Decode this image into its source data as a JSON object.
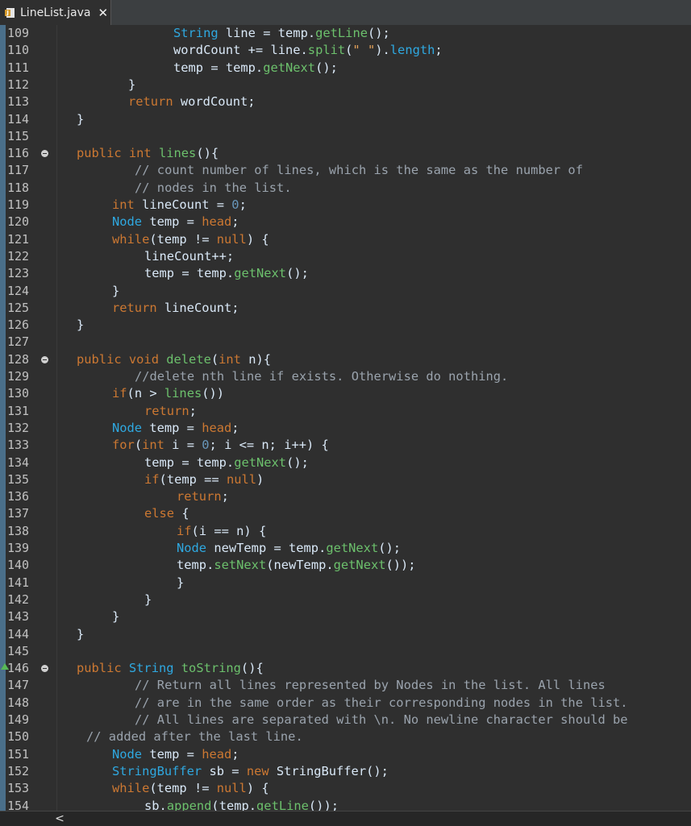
{
  "tab": {
    "label": "LineList.java",
    "close": "✕"
  },
  "scroll": {
    "left": "<"
  },
  "lines": [
    {
      "n": "109",
      "indent": 4,
      "fold": false,
      "marker": false,
      "tokens": [
        [
          "ty",
          "String"
        ],
        [
          "id",
          " line "
        ],
        [
          "id",
          "= "
        ],
        [
          "id",
          "temp."
        ],
        [
          "fn",
          "getLine"
        ],
        [
          "id",
          "();"
        ]
      ]
    },
    {
      "n": "110",
      "indent": 4,
      "fold": false,
      "marker": false,
      "tokens": [
        [
          "id",
          "wordCount += line."
        ],
        [
          "fn",
          "split"
        ],
        [
          "id",
          "("
        ],
        [
          "str",
          "\" \""
        ],
        [
          "id",
          ")."
        ],
        [
          "ty",
          "length"
        ],
        [
          "id",
          ";"
        ]
      ]
    },
    {
      "n": "111",
      "indent": 4,
      "fold": false,
      "marker": false,
      "tokens": [
        [
          "id",
          "temp = temp."
        ],
        [
          "fn",
          "getNext"
        ],
        [
          "id",
          "();"
        ]
      ]
    },
    {
      "n": "112",
      "indent": 2.6,
      "fold": false,
      "marker": false,
      "tokens": [
        [
          "id",
          "}"
        ]
      ]
    },
    {
      "n": "113",
      "indent": 2.6,
      "fold": false,
      "marker": false,
      "tokens": [
        [
          "kw",
          "return"
        ],
        [
          "id",
          " wordCount;"
        ]
      ]
    },
    {
      "n": "114",
      "indent": 1,
      "fold": false,
      "marker": false,
      "tokens": [
        [
          "id",
          "}"
        ]
      ]
    },
    {
      "n": "115",
      "indent": 0,
      "fold": false,
      "marker": false,
      "tokens": []
    },
    {
      "n": "116",
      "indent": 1,
      "fold": true,
      "marker": false,
      "tokens": [
        [
          "kw",
          "public"
        ],
        [
          "id",
          " "
        ],
        [
          "kw",
          "int"
        ],
        [
          "id",
          " "
        ],
        [
          "fn",
          "lines"
        ],
        [
          "id",
          "(){"
        ]
      ]
    },
    {
      "n": "117",
      "indent": 2.8,
      "fold": false,
      "marker": false,
      "tokens": [
        [
          "cm",
          "// count number of lines, which is the same as the number of"
        ]
      ]
    },
    {
      "n": "118",
      "indent": 2.8,
      "fold": false,
      "marker": false,
      "tokens": [
        [
          "cm",
          "// nodes in the list."
        ]
      ]
    },
    {
      "n": "119",
      "indent": 2.1,
      "fold": false,
      "marker": false,
      "tokens": [
        [
          "kw",
          "int"
        ],
        [
          "id",
          " lineCount = "
        ],
        [
          "num",
          "0"
        ],
        [
          "id",
          ";"
        ]
      ]
    },
    {
      "n": "120",
      "indent": 2.1,
      "fold": false,
      "marker": false,
      "tokens": [
        [
          "ty",
          "Node"
        ],
        [
          "id",
          " temp = "
        ],
        [
          "kw",
          "head"
        ],
        [
          "id",
          ";"
        ]
      ]
    },
    {
      "n": "121",
      "indent": 2.1,
      "fold": false,
      "marker": false,
      "tokens": [
        [
          "kw",
          "while"
        ],
        [
          "id",
          "(temp != "
        ],
        [
          "kw",
          "null"
        ],
        [
          "id",
          ") {"
        ]
      ]
    },
    {
      "n": "122",
      "indent": 3.1,
      "fold": false,
      "marker": false,
      "tokens": [
        [
          "id",
          "lineCount++;"
        ]
      ]
    },
    {
      "n": "123",
      "indent": 3.1,
      "fold": false,
      "marker": false,
      "tokens": [
        [
          "id",
          "temp = temp."
        ],
        [
          "fn",
          "getNext"
        ],
        [
          "id",
          "();"
        ]
      ]
    },
    {
      "n": "124",
      "indent": 2.1,
      "fold": false,
      "marker": false,
      "tokens": [
        [
          "id",
          "}"
        ]
      ]
    },
    {
      "n": "125",
      "indent": 2.1,
      "fold": false,
      "marker": false,
      "tokens": [
        [
          "kw",
          "return"
        ],
        [
          "id",
          " lineCount;"
        ]
      ]
    },
    {
      "n": "126",
      "indent": 1,
      "fold": false,
      "marker": false,
      "tokens": [
        [
          "id",
          "}"
        ]
      ]
    },
    {
      "n": "127",
      "indent": 0,
      "fold": false,
      "marker": false,
      "tokens": []
    },
    {
      "n": "128",
      "indent": 1,
      "fold": true,
      "marker": false,
      "tokens": [
        [
          "kw",
          "public"
        ],
        [
          "id",
          " "
        ],
        [
          "kw",
          "void"
        ],
        [
          "id",
          " "
        ],
        [
          "fn",
          "delete"
        ],
        [
          "id",
          "("
        ],
        [
          "kw",
          "int"
        ],
        [
          "id",
          " n){"
        ]
      ]
    },
    {
      "n": "129",
      "indent": 2.8,
      "fold": false,
      "marker": false,
      "tokens": [
        [
          "cm",
          "//delete nth line if exists. Otherwise do nothing."
        ]
      ]
    },
    {
      "n": "130",
      "indent": 2.1,
      "fold": false,
      "marker": false,
      "tokens": [
        [
          "kw",
          "if"
        ],
        [
          "id",
          "(n > "
        ],
        [
          "fn",
          "lines"
        ],
        [
          "id",
          "())"
        ]
      ]
    },
    {
      "n": "131",
      "indent": 3.1,
      "fold": false,
      "marker": false,
      "tokens": [
        [
          "kw",
          "return"
        ],
        [
          "id",
          ";"
        ]
      ]
    },
    {
      "n": "132",
      "indent": 2.1,
      "fold": false,
      "marker": false,
      "tokens": [
        [
          "ty",
          "Node"
        ],
        [
          "id",
          " temp = "
        ],
        [
          "kw",
          "head"
        ],
        [
          "id",
          ";"
        ]
      ]
    },
    {
      "n": "133",
      "indent": 2.1,
      "fold": false,
      "marker": false,
      "tokens": [
        [
          "kw",
          "for"
        ],
        [
          "id",
          "("
        ],
        [
          "kw",
          "int"
        ],
        [
          "id",
          " i = "
        ],
        [
          "num",
          "0"
        ],
        [
          "id",
          "; i <= n; i++) {"
        ]
      ]
    },
    {
      "n": "134",
      "indent": 3.1,
      "fold": false,
      "marker": false,
      "tokens": [
        [
          "id",
          "temp = temp."
        ],
        [
          "fn",
          "getNext"
        ],
        [
          "id",
          "();"
        ]
      ]
    },
    {
      "n": "135",
      "indent": 3.1,
      "fold": false,
      "marker": false,
      "tokens": [
        [
          "kw",
          "if"
        ],
        [
          "id",
          "(temp == "
        ],
        [
          "kw",
          "null"
        ],
        [
          "id",
          ")"
        ]
      ]
    },
    {
      "n": "136",
      "indent": 4.1,
      "fold": false,
      "marker": false,
      "tokens": [
        [
          "kw",
          "return"
        ],
        [
          "id",
          ";"
        ]
      ]
    },
    {
      "n": "137",
      "indent": 3.1,
      "fold": false,
      "marker": false,
      "tokens": [
        [
          "kw",
          "else"
        ],
        [
          "id",
          " {"
        ]
      ]
    },
    {
      "n": "138",
      "indent": 4.1,
      "fold": false,
      "marker": false,
      "tokens": [
        [
          "kw",
          "if"
        ],
        [
          "id",
          "(i == n) {"
        ]
      ]
    },
    {
      "n": "139",
      "indent": 4.1,
      "fold": false,
      "marker": false,
      "tokens": [
        [
          "ty",
          "Node"
        ],
        [
          "id",
          " newTemp = temp."
        ],
        [
          "fn",
          "getNext"
        ],
        [
          "id",
          "();"
        ]
      ]
    },
    {
      "n": "140",
      "indent": 4.1,
      "fold": false,
      "marker": false,
      "tokens": [
        [
          "id",
          "temp."
        ],
        [
          "fn",
          "setNext"
        ],
        [
          "id",
          "(newTemp."
        ],
        [
          "fn",
          "getNext"
        ],
        [
          "id",
          "());"
        ]
      ]
    },
    {
      "n": "141",
      "indent": 4.1,
      "fold": false,
      "marker": false,
      "tokens": [
        [
          "id",
          "}"
        ]
      ]
    },
    {
      "n": "142",
      "indent": 3.1,
      "fold": false,
      "marker": false,
      "tokens": [
        [
          "id",
          "}"
        ]
      ]
    },
    {
      "n": "143",
      "indent": 2.1,
      "fold": false,
      "marker": false,
      "tokens": [
        [
          "id",
          "}"
        ]
      ]
    },
    {
      "n": "144",
      "indent": 1,
      "fold": false,
      "marker": false,
      "tokens": [
        [
          "id",
          "}"
        ]
      ]
    },
    {
      "n": "145",
      "indent": 0,
      "fold": false,
      "marker": false,
      "tokens": []
    },
    {
      "n": "146",
      "indent": 1,
      "fold": true,
      "marker": true,
      "tokens": [
        [
          "kw",
          "public"
        ],
        [
          "id",
          " "
        ],
        [
          "ty",
          "String"
        ],
        [
          "id",
          " "
        ],
        [
          "fn",
          "toString"
        ],
        [
          "id",
          "(){"
        ]
      ]
    },
    {
      "n": "147",
      "indent": 2.8,
      "fold": false,
      "marker": false,
      "tokens": [
        [
          "cm",
          "// Return all lines represented by Nodes in the list. All lines"
        ]
      ]
    },
    {
      "n": "148",
      "indent": 2.8,
      "fold": false,
      "marker": false,
      "tokens": [
        [
          "cm",
          "// are in the same order as their corresponding nodes in the list."
        ]
      ]
    },
    {
      "n": "149",
      "indent": 2.8,
      "fold": false,
      "marker": false,
      "tokens": [
        [
          "cm",
          "// All lines are separated with \\n. No newline character should be"
        ]
      ]
    },
    {
      "n": "150",
      "indent": 1.3,
      "fold": false,
      "marker": false,
      "tokens": [
        [
          "cm",
          "// added after the last line."
        ]
      ]
    },
    {
      "n": "151",
      "indent": 2.1,
      "fold": false,
      "marker": false,
      "tokens": [
        [
          "ty",
          "Node"
        ],
        [
          "id",
          " temp = "
        ],
        [
          "kw",
          "head"
        ],
        [
          "id",
          ";"
        ]
      ]
    },
    {
      "n": "152",
      "indent": 2.1,
      "fold": false,
      "marker": false,
      "tokens": [
        [
          "ty",
          "StringBuffer"
        ],
        [
          "id",
          " sb = "
        ],
        [
          "kw",
          "new"
        ],
        [
          "id",
          " StringBuffer();"
        ]
      ]
    },
    {
      "n": "153",
      "indent": 2.1,
      "fold": false,
      "marker": false,
      "tokens": [
        [
          "kw",
          "while"
        ],
        [
          "id",
          "(temp != "
        ],
        [
          "kw",
          "null"
        ],
        [
          "id",
          ") {"
        ]
      ]
    },
    {
      "n": "154",
      "indent": 3.1,
      "fold": false,
      "marker": false,
      "tokens": [
        [
          "id",
          "sb."
        ],
        [
          "fn",
          "append"
        ],
        [
          "id",
          "(temp."
        ],
        [
          "fn",
          "getLine"
        ],
        [
          "id",
          "());"
        ]
      ]
    }
  ]
}
